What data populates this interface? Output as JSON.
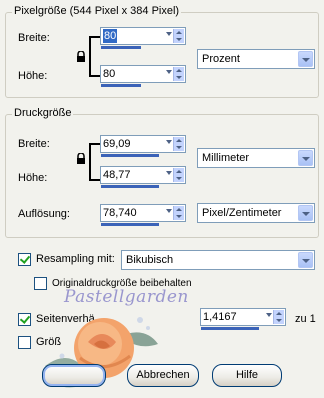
{
  "pixel_size": {
    "legend": "Pixelgröße (544 Pixel x 384 Pixel)",
    "width_label": "Breite:",
    "width_value": "80",
    "height_label": "Höhe:",
    "height_value": "80",
    "unit": "Prozent"
  },
  "print_size": {
    "legend": "Druckgröße",
    "width_label": "Breite:",
    "width_value": "69,09",
    "height_label": "Höhe:",
    "height_value": "48,77",
    "unit": "Millimeter",
    "resolution_label": "Auflösung:",
    "resolution_value": "78,740",
    "resolution_unit": "Pixel/Zentimeter"
  },
  "resampling": {
    "label": "Resampling mit:",
    "checked": true,
    "method": "Bikubisch"
  },
  "keep_original": {
    "label": "Originaldruckgröße beibehalten",
    "checked": false
  },
  "aspect": {
    "label": "Seitenverhä",
    "checked": true,
    "value": "1,4167",
    "suffix": "zu 1"
  },
  "resize_all": {
    "label": "Größ",
    "checked": false
  },
  "watermark": {
    "text": "Pastellgarden"
  },
  "buttons": {
    "ok": "",
    "cancel": "Abbrechen",
    "help": "Hilfe"
  }
}
